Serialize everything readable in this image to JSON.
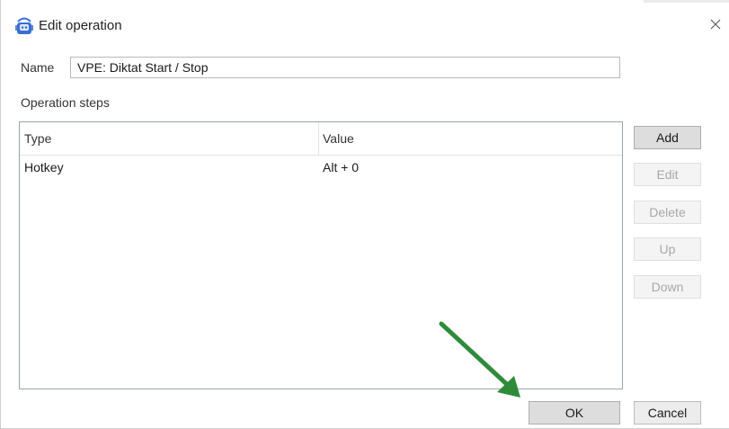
{
  "window": {
    "title": "Edit operation"
  },
  "name_field": {
    "label": "Name",
    "value": "VPE: Diktat Start / Stop"
  },
  "steps": {
    "label": "Operation steps",
    "columns": [
      "Type",
      "Value"
    ],
    "rows": [
      {
        "type": "Hotkey",
        "value": "Alt + 0"
      }
    ]
  },
  "side_buttons": {
    "add": "Add",
    "edit": "Edit",
    "delete": "Delete",
    "up": "Up",
    "down": "Down"
  },
  "footer_buttons": {
    "ok": "OK",
    "cancel": "Cancel"
  },
  "icons": {
    "app": "robot-app-icon",
    "close": "close-icon",
    "annotation": "green-arrow-annotation"
  },
  "colors": {
    "annotation_arrow": "#2e8b3a",
    "app_icon": "#3a6fd0"
  }
}
